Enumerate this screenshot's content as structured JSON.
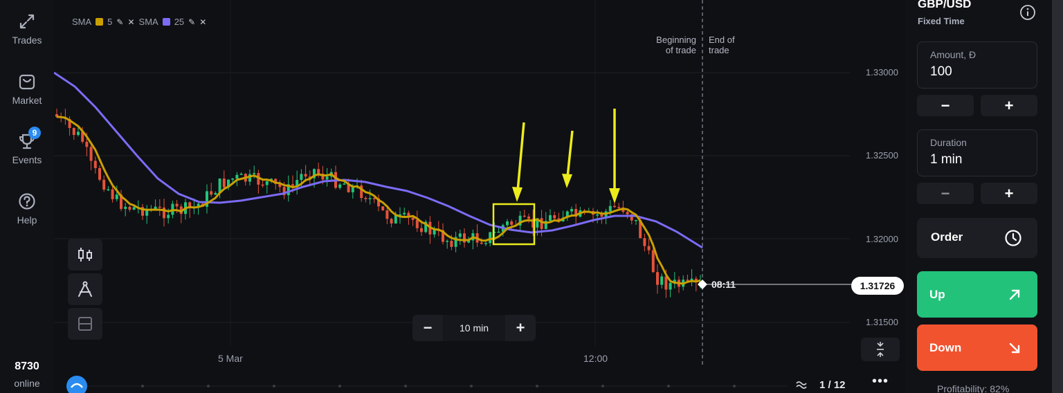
{
  "nav": {
    "trades": "Trades",
    "market": "Market",
    "events": "Events",
    "events_badge": "9",
    "help": "Help",
    "online_count": "8730",
    "online_label": "online"
  },
  "chart": {
    "legend": {
      "sma1_label": "SMA",
      "sma1_period": "5",
      "sma1_color": "#c9a000",
      "sma2_label": "SMA",
      "sma2_period": "25",
      "sma2_color": "#7b6cf6"
    },
    "price_ticks": [
      "1.33000",
      "1.32500",
      "1.32000",
      "1.31500"
    ],
    "time_ticks": [
      "5 Mar",
      "12:00"
    ],
    "beginning_label_1": "Beginning",
    "beginning_label_2": "of trade",
    "end_label_1": "End of",
    "end_label_2": "trade",
    "current_price": "1.31726",
    "countdown": "08:11",
    "zoom_minus": "−",
    "zoom_value": "10 min",
    "zoom_plus": "+",
    "page": "1 / 12",
    "more": "•••"
  },
  "colors": {
    "up_candle": "#23c47a",
    "down_candle": "#e5533a",
    "annotation": "#ecec1c",
    "up_button": "#22c27a",
    "down_button": "#f2532f"
  },
  "panel": {
    "pair": "GBP/USD",
    "mode": "Fixed Time",
    "amount_label": "Amount, Đ",
    "amount_value": "100",
    "duration_label": "Duration",
    "duration_value": "1 min",
    "minus": "−",
    "plus": "+",
    "order_label": "Order",
    "up_label": "Up",
    "down_label": "Down",
    "profitability": "Profitability: 82%"
  }
}
